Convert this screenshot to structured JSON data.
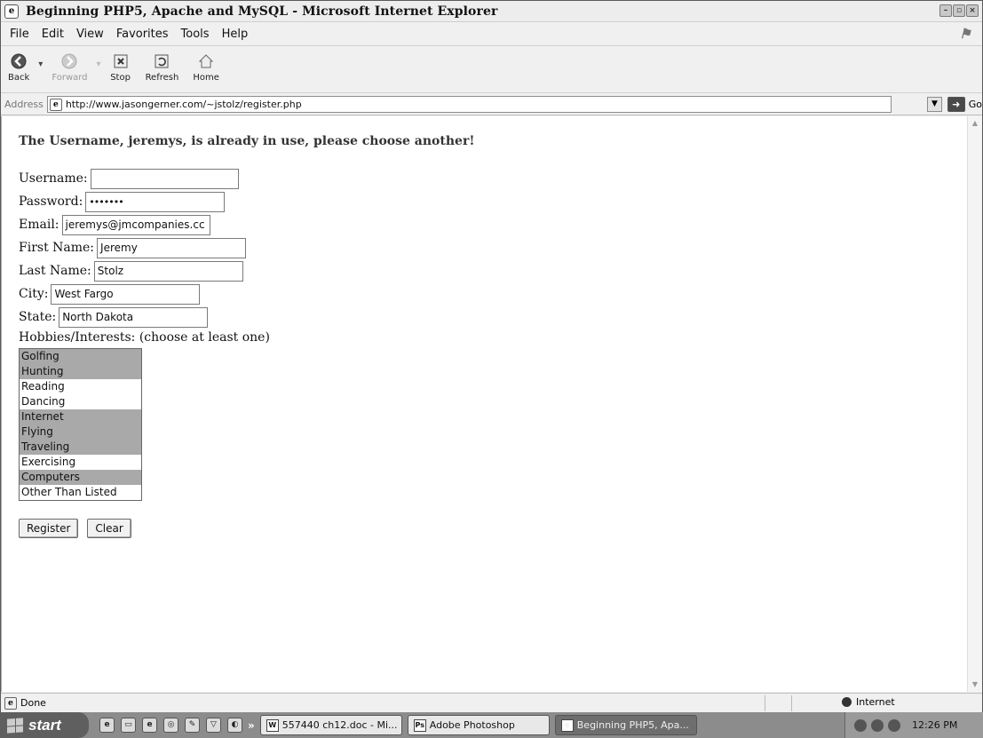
{
  "window": {
    "title": "Beginning PHP5, Apache and MySQL - Microsoft Internet Explorer"
  },
  "menu": [
    "File",
    "Edit",
    "View",
    "Favorites",
    "Tools",
    "Help"
  ],
  "toolbar": {
    "back": "Back",
    "forward": "Forward",
    "stop": "Stop",
    "refresh": "Refresh",
    "home": "Home"
  },
  "address": {
    "label": "Address",
    "url": "http://www.jasongerner.com/~jstolz/register.php",
    "go": "Go"
  },
  "page": {
    "message": "The Username, jeremys, is already in use, please choose another!",
    "fields": {
      "username": {
        "label": "Username:",
        "value": ""
      },
      "password": {
        "label": "Password:",
        "value": "•••••••"
      },
      "email": {
        "label": "Email:",
        "value": "jeremys@jmcompanies.cc"
      },
      "first_name": {
        "label": "First Name:",
        "value": "Jeremy"
      },
      "last_name": {
        "label": "Last Name:",
        "value": "Stolz"
      },
      "city": {
        "label": "City:",
        "value": "West Fargo"
      },
      "state": {
        "label": "State:",
        "value": "North Dakota"
      }
    },
    "hobbies_label": "Hobbies/Interests: (choose at least one)",
    "hobbies": [
      {
        "label": "Golfing",
        "selected": true
      },
      {
        "label": "Hunting",
        "selected": true
      },
      {
        "label": "Reading",
        "selected": false
      },
      {
        "label": "Dancing",
        "selected": false
      },
      {
        "label": "Internet",
        "selected": true
      },
      {
        "label": "Flying",
        "selected": true
      },
      {
        "label": "Traveling",
        "selected": true
      },
      {
        "label": "Exercising",
        "selected": false
      },
      {
        "label": "Computers",
        "selected": true
      },
      {
        "label": "Other Than Listed",
        "selected": false
      }
    ],
    "register_label": "Register",
    "clear_label": "Clear"
  },
  "status": {
    "text": "Done",
    "zone": "Internet"
  },
  "taskbar": {
    "start": "start",
    "tasks": [
      "557440 ch12.doc - Mi...",
      "Adobe Photoshop",
      "Beginning PHP5, Apa..."
    ],
    "clock": "12:26 PM"
  }
}
